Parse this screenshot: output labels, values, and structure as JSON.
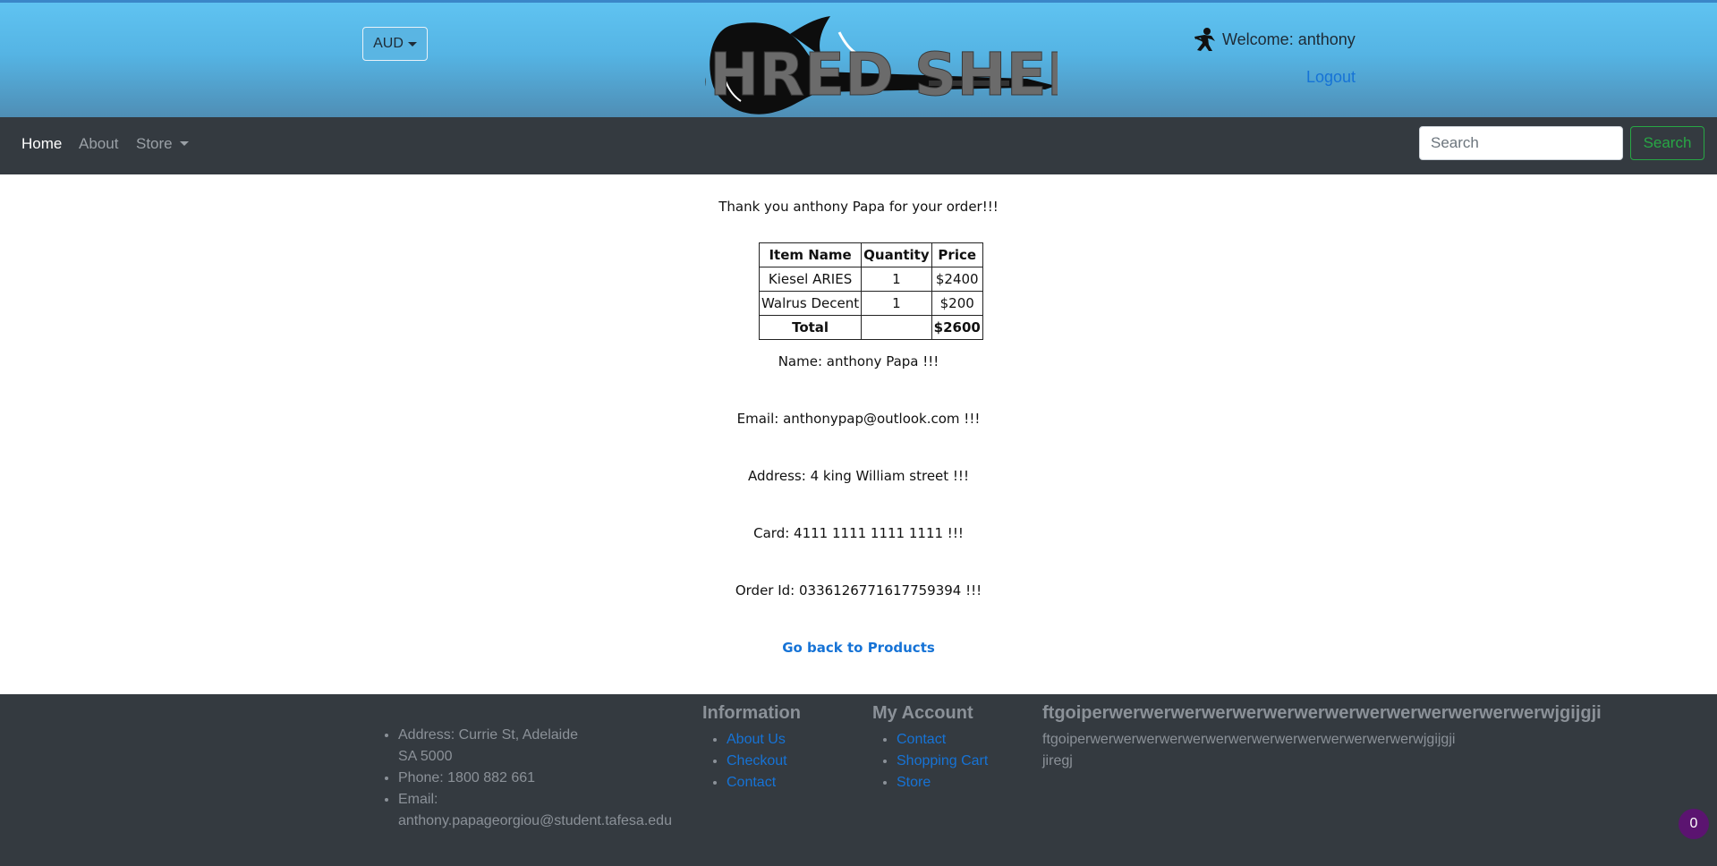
{
  "header": {
    "currency": "AUD",
    "logo_text": "SHRED SHED",
    "welcome": "Welcome: anthony",
    "logout": "Logout"
  },
  "nav": {
    "home": "Home",
    "about": "About",
    "store": "Store",
    "search_placeholder": "Search",
    "search_button": "Search"
  },
  "order": {
    "thanks": "Thank you anthony Papa for your order!!!",
    "columns": [
      "Item Name",
      "Quantity",
      "Price"
    ],
    "rows": [
      {
        "name": "Kiesel ARIES",
        "qty": "1",
        "price": "$2400"
      },
      {
        "name": "Walrus Decent",
        "qty": "1",
        "price": "$200"
      }
    ],
    "total_label": "Total",
    "total_value": "$2600",
    "name_line": "Name: anthony Papa !!!",
    "email_line": "Email: anthonypap@outlook.com !!!",
    "address_line": "Address: 4 king William street !!!",
    "card_line": "Card: 4111 1111 1111 1111 !!!",
    "order_id_line": "Order Id: 0336126771617759394 !!!",
    "back_link": "Go back to Products"
  },
  "footer": {
    "contact": {
      "address_line1": "Address: Currie St, Adelaide",
      "address_line2": "SA 5000",
      "phone": "Phone: 1800 882 661",
      "email_label": "Email:",
      "email_value": "anthony.papageorgiou@student.tafesa.edu"
    },
    "information": {
      "title": "Information",
      "links": [
        "About Us",
        "Checkout",
        "Contact"
      ]
    },
    "my_account": {
      "title": "My Account",
      "links": [
        "Contact",
        "Shopping Cart",
        "Store"
      ]
    },
    "misc": {
      "title": "ftgoiperwerwerwerwerwerwerwerwerwerwerwerwerwerwerwjgijgji",
      "line1": "ftgoiperwerwerwerwerwerwerwerwerwerwerwerwerwerwerwjgijgji",
      "line2": "jiregj"
    }
  },
  "cart_badge": "0"
}
